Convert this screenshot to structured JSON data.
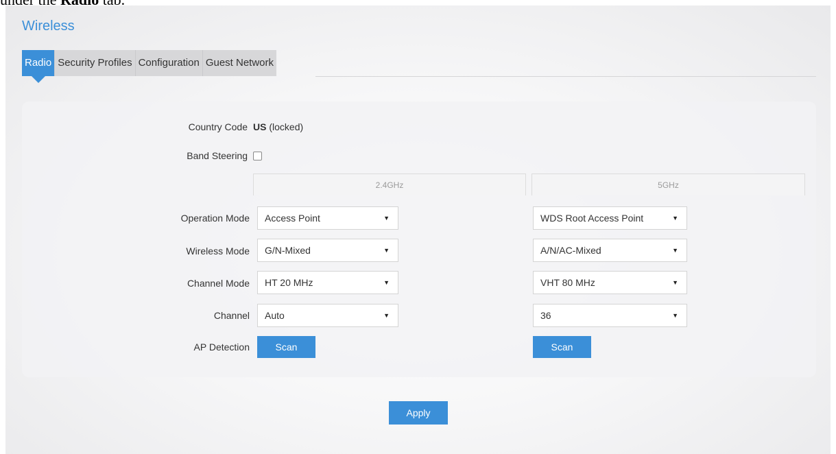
{
  "caption": {
    "prefix": "under the ",
    "bold": "Radio",
    "suffix": " tab."
  },
  "page": {
    "title": "Wireless"
  },
  "tabs": [
    {
      "label": "Radio",
      "active": true
    },
    {
      "label": "Security Profiles",
      "active": false
    },
    {
      "label": "Configuration",
      "active": false
    },
    {
      "label": "Guest Network",
      "active": false
    }
  ],
  "country": {
    "label": "Country Code",
    "code": "US",
    "note": "(locked)"
  },
  "band_steering": {
    "label": "Band Steering",
    "checked": false
  },
  "bands": {
    "b24": "2.4GHz",
    "b5": "5GHz"
  },
  "rows": {
    "operation_mode": {
      "label": "Operation Mode",
      "b24": "Access Point",
      "b5": "WDS Root Access Point"
    },
    "wireless_mode": {
      "label": "Wireless Mode",
      "b24": "G/N-Mixed",
      "b5": "A/N/AC-Mixed"
    },
    "channel_mode": {
      "label": "Channel Mode",
      "b24": "HT 20 MHz",
      "b5": "VHT 80 MHz"
    },
    "channel": {
      "label": "Channel",
      "b24": "Auto",
      "b5": "36"
    }
  },
  "ap_detection": {
    "label": "AP Detection",
    "scan_label": "Scan"
  },
  "apply_label": "Apply",
  "icons": {
    "dropdown": "triangle-down-icon"
  },
  "colors": {
    "accent": "#3b8fd8",
    "tab_bg": "#d7d7d9"
  }
}
